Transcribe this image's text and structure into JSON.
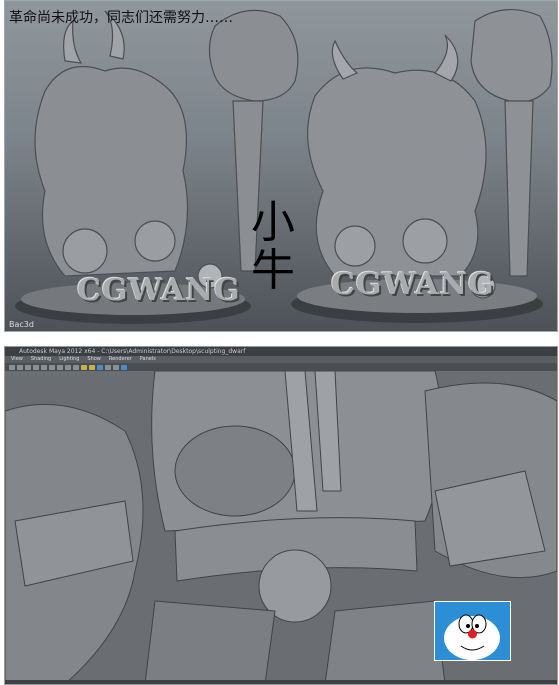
{
  "caption": "革命尚未成功，同志们还需努力……",
  "watermark_left": "CGWANG",
  "watermark_right": "CGWANG",
  "overlay_text": {
    "line1": "小",
    "line2": "牛"
  },
  "corner_logo": "Bac3d",
  "maya": {
    "title": "Autodesk Maya 2012 x64 - C:\\Users\\Administrator\\Desktop\\sculpting_dwarf",
    "menu": [
      "View",
      "Shading",
      "Lighting",
      "Show",
      "Renderer",
      "Panels"
    ]
  },
  "colors": {
    "viewport": "#6f7478",
    "doraemon_blue": "#2c8fd6"
  }
}
